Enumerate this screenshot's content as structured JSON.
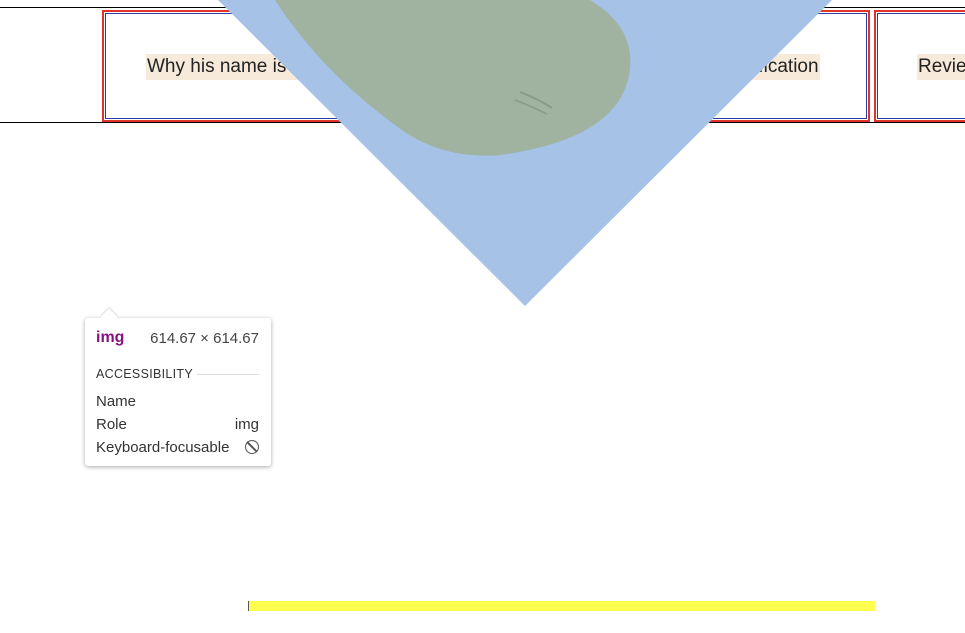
{
  "tabs": [
    {
      "label": "Why his name is David"
    },
    {
      "label": "Detailed specification"
    },
    {
      "label": "Reviews"
    }
  ],
  "tooltip": {
    "tag": "img",
    "dimensions": "614.67 × 614.67",
    "section": "ACCESSIBILITY",
    "rows": [
      {
        "label": "Name",
        "value": ""
      },
      {
        "label": "Role",
        "value": "img"
      },
      {
        "label": "Keyboard-focusable",
        "icon": "not-allowed-icon"
      }
    ]
  },
  "colors": {
    "overlay_blue": "#a6c2e6",
    "tab_border_red": "#e0342b",
    "tab_border_blue": "#2c3fa0",
    "label_highlight": "#f7eadb",
    "highlight_bar": "#ffff4f",
    "tag_purple": "#881280"
  }
}
